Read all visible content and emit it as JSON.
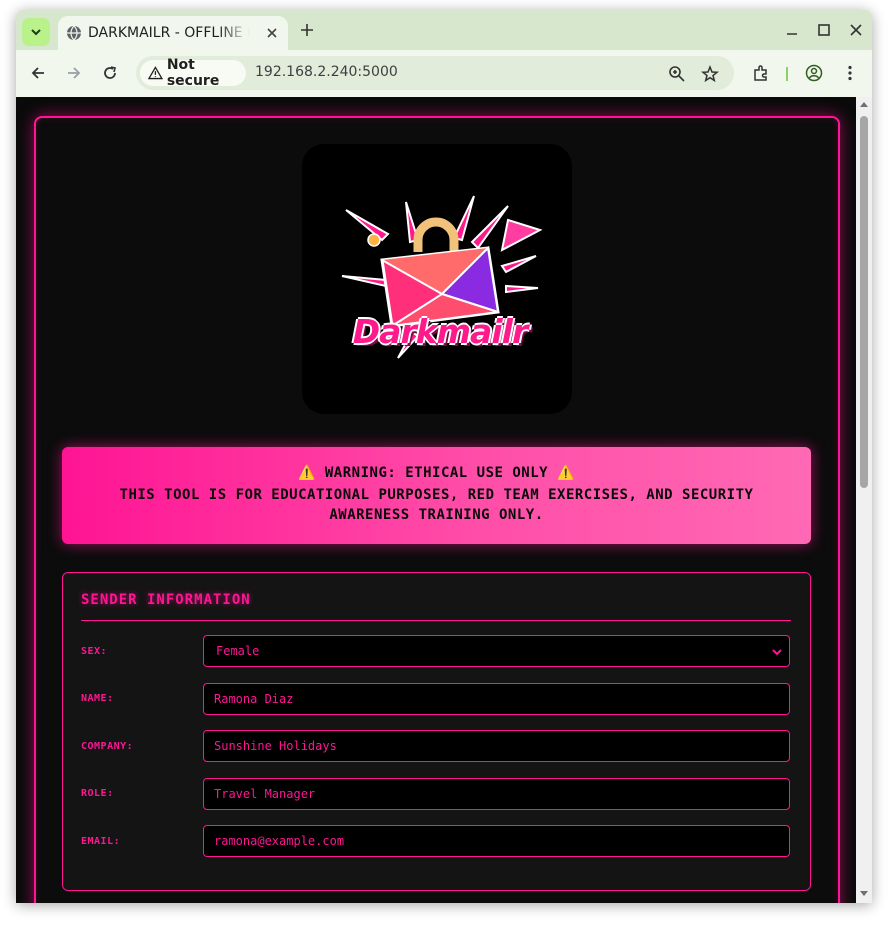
{
  "browser": {
    "tab_title": "DARKMAILR - OFFLINE PHISHING",
    "security_label": "Not secure",
    "url": "192.168.2.240:5000"
  },
  "page": {
    "logo_text": "Darkmailr",
    "warning": {
      "title": "⚠️ WARNING: ETHICAL USE ONLY ⚠️",
      "body": "THIS TOOL IS FOR EDUCATIONAL PURPOSES, RED TEAM EXERCISES, AND SECURITY AWARENESS TRAINING ONLY."
    },
    "sender": {
      "section_title": "SENDER INFORMATION",
      "sex_label": "SEX:",
      "sex_value": "Female",
      "name_label": "NAME:",
      "name_value": "Ramona Diaz",
      "company_label": "COMPANY:",
      "company_value": "Sunshine Holidays",
      "role_label": "ROLE:",
      "role_value": "Travel Manager",
      "email_label": "EMAIL:",
      "email_value": "ramona@example.com"
    }
  },
  "colors": {
    "accent": "#ff1493",
    "background": "#0a0a0a",
    "panel": "#141414"
  }
}
